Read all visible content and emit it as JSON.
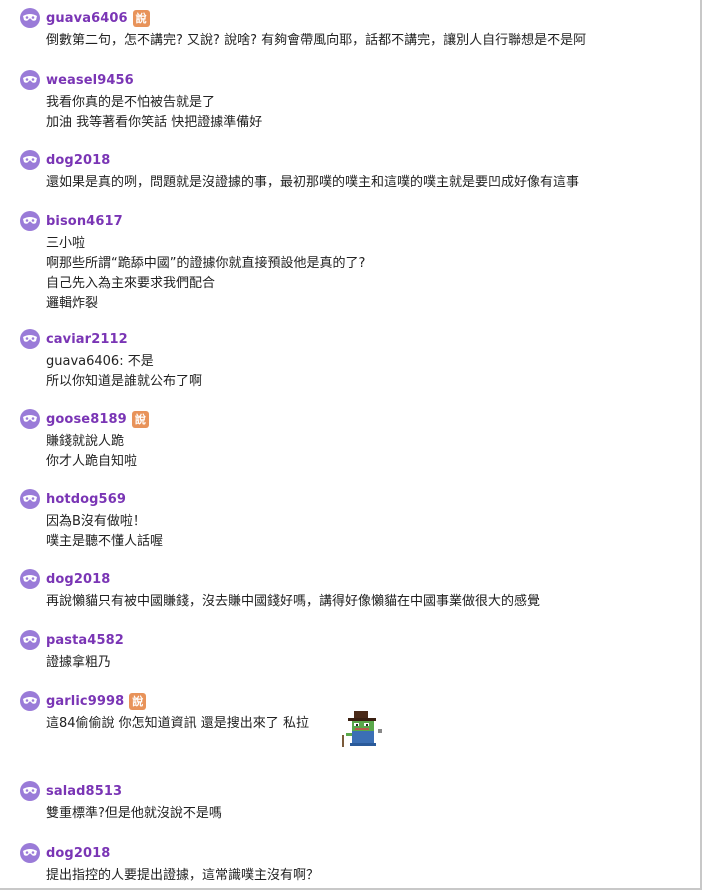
{
  "comments": [
    {
      "user": "guava6406",
      "op": true,
      "badge": "說",
      "lines": [
        "倒數第二句，怎不講完? 又說? 說啥? 有夠會帶風向耶，話都不講完，讓別人自行聯想是不是阿"
      ]
    },
    {
      "user": "weasel9456",
      "op": false,
      "lines": [
        "我看你真的是不怕被告就是了",
        "加油 我等著看你笑話 快把證據準備好"
      ]
    },
    {
      "user": "dog2018",
      "op": false,
      "lines": [
        "還如果是真的咧，問題就是沒證據的事，最初那噗的噗主和這噗的噗主就是要凹成好像有這事"
      ]
    },
    {
      "user": "bison4617",
      "op": false,
      "lines": [
        "三小啦",
        "啊那些所謂“跪舔中國”的證據你就直接預設他是真的了?",
        "自己先入為主來要求我們配合",
        "邏輯炸裂"
      ]
    },
    {
      "user": "caviar2112",
      "op": false,
      "lines": [
        "guava6406: 不是",
        "所以你知道是誰就公布了啊"
      ]
    },
    {
      "user": "goose8189",
      "op": true,
      "badge": "說",
      "lines": [
        "賺錢就說人跪",
        "你才人跪自知啦"
      ]
    },
    {
      "user": "hotdog569",
      "op": false,
      "lines": [
        "因為B沒有做啦！",
        "噗主是聽不懂人話喔"
      ]
    },
    {
      "user": "dog2018",
      "op": false,
      "lines": [
        "再說懶貓只有被中國賺錢，沒去賺中國錢好嗎，講得好像懶貓在中國事業做很大的感覺"
      ]
    },
    {
      "user": "pasta4582",
      "op": false,
      "lines": [
        "證據拿粗乃"
      ]
    },
    {
      "user": "garlic9998",
      "op": true,
      "badge": "說",
      "lines": [
        "這84偷偷說 你怎知道資訊 還是搜出來了 私拉"
      ],
      "sticker": "frog-cowboy-sticker"
    },
    {
      "user": "salad8513",
      "op": false,
      "lines": [
        "雙重標準?但是他就沒說不是嗎"
      ]
    },
    {
      "user": "dog2018",
      "op": false,
      "lines": [
        "提出指控的人要提出證據，這常識噗主沒有啊？"
      ]
    }
  ]
}
